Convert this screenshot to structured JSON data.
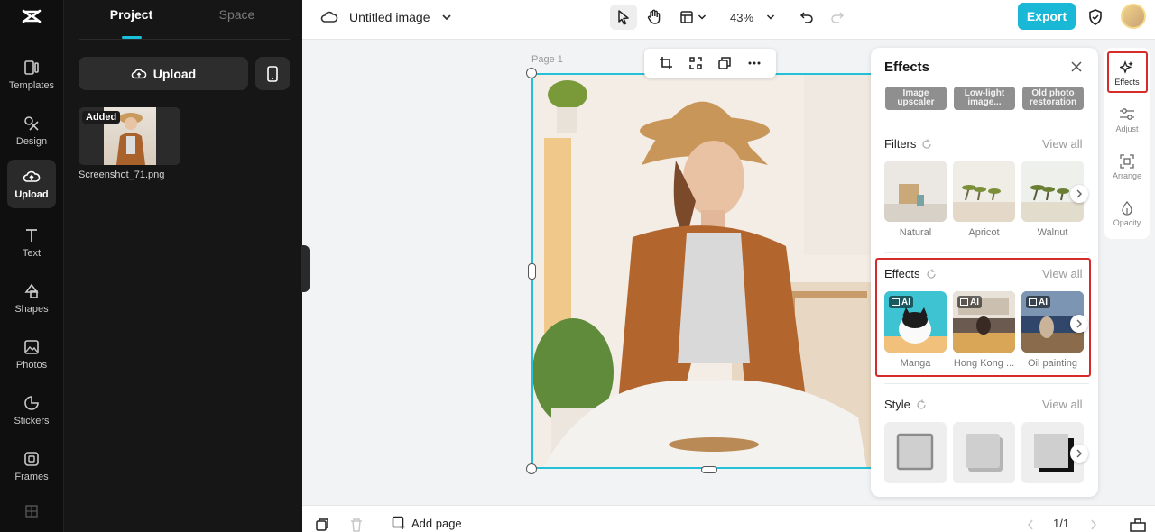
{
  "rail": {
    "items": [
      {
        "label": "Templates",
        "icon": "templates-icon"
      },
      {
        "label": "Design",
        "icon": "design-icon"
      },
      {
        "label": "Upload",
        "icon": "upload-cloud-icon",
        "active": true
      },
      {
        "label": "Text",
        "icon": "text-icon"
      },
      {
        "label": "Shapes",
        "icon": "shapes-icon"
      },
      {
        "label": "Photos",
        "icon": "photos-icon"
      },
      {
        "label": "Stickers",
        "icon": "stickers-icon"
      },
      {
        "label": "Frames",
        "icon": "frames-icon"
      }
    ]
  },
  "panel": {
    "tabs": [
      "Project",
      "Space"
    ],
    "upload_label": "Upload",
    "asset": {
      "badge": "Added",
      "name": "Screenshot_71.png"
    }
  },
  "topbar": {
    "doc_title": "Untitled image",
    "zoom": "43%",
    "export_label": "Export"
  },
  "canvas": {
    "page_label": "Page 1"
  },
  "effects_panel": {
    "title": "Effects",
    "chips": [
      "Image upscaler",
      "Low-light image...",
      "Old photo restoration"
    ],
    "filters": {
      "title": "Filters",
      "view_all": "View all",
      "items": [
        "Natural",
        "Apricot",
        "Walnut"
      ]
    },
    "effects": {
      "title": "Effects",
      "view_all": "View all",
      "ai_badge": "AI",
      "items": [
        "Manga",
        "Hong Kong ...",
        "Oil painting"
      ]
    },
    "style": {
      "title": "Style",
      "view_all": "View all"
    }
  },
  "right_rail": {
    "items": [
      "Effects",
      "Adjust",
      "Arrange",
      "Opacity"
    ]
  },
  "bottombar": {
    "add_page": "Add page",
    "pager": "1/1"
  },
  "colors": {
    "accent": "#18b8d6",
    "highlight": "#d62b2b",
    "dark_bg": "#0f0f0f"
  }
}
